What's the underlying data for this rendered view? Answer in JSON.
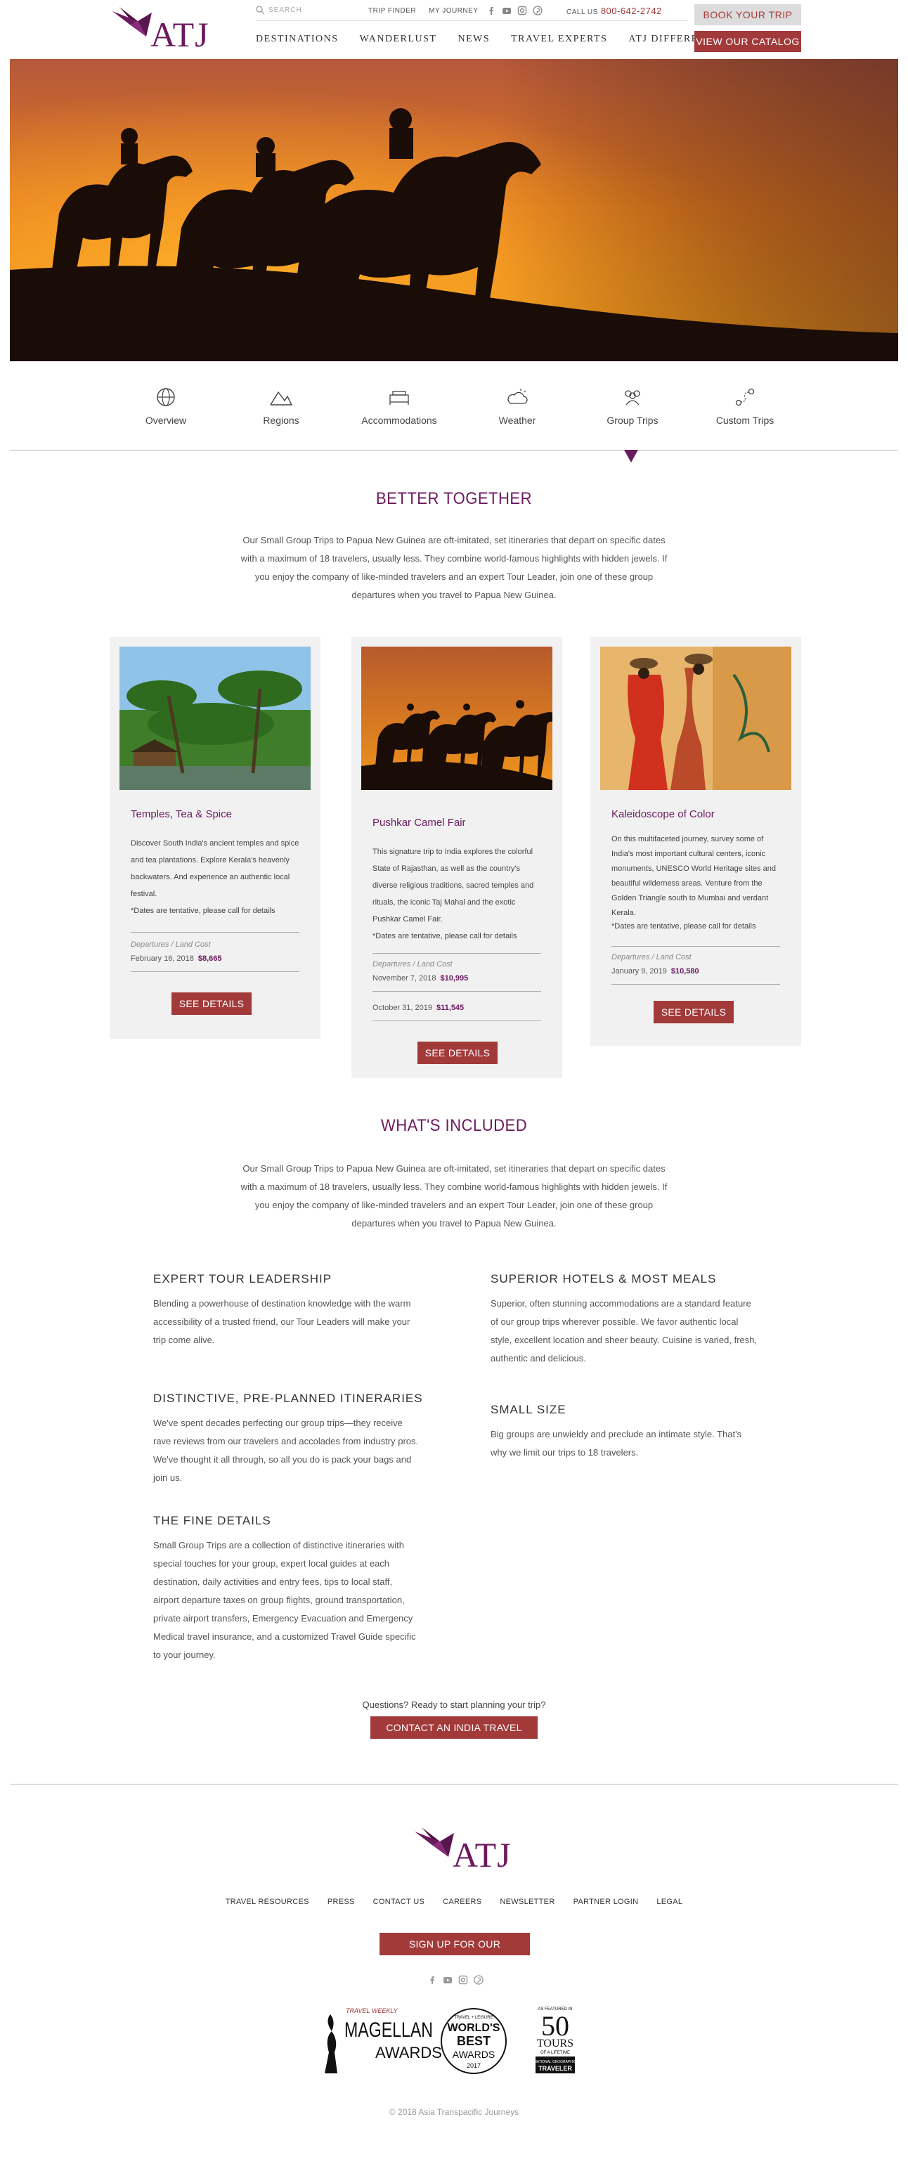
{
  "brand": {
    "logo_text": "ATJ",
    "plum": "#6b1a5e",
    "red": "#a33a3a"
  },
  "header": {
    "search_placeholder": "SEARCH",
    "top_links": [
      "TRIP FINDER",
      "MY JOURNEY"
    ],
    "social_icons": [
      "facebook-icon",
      "youtube-icon",
      "instagram-icon",
      "pinterest-icon"
    ],
    "call_label": "CALL US",
    "phone": "800-642-2742",
    "nav": [
      "DESTINATIONS",
      "WANDERLUST",
      "NEWS",
      "TRAVEL EXPERTS",
      "ATJ DIFFERENCE"
    ],
    "book_button": "BOOK YOUR TRIP",
    "catalog_button": "VIEW OUR CATALOG"
  },
  "tabs": [
    {
      "label": "Overview",
      "icon": "globe-icon"
    },
    {
      "label": "Regions",
      "icon": "mountains-icon"
    },
    {
      "label": "Accommodations",
      "icon": "hotel-icon"
    },
    {
      "label": "Weather",
      "icon": "cloud-sun-icon"
    },
    {
      "label": "Group Trips",
      "icon": "group-icon",
      "active": true
    },
    {
      "label": "Custom Trips",
      "icon": "route-icon"
    }
  ],
  "better_together": {
    "title": "BETTER TOGETHER",
    "intro": "Our Small Group Trips to Papua New Guinea are oft-imitated, set itineraries that depart on specific dates with a maximum of 18 travelers, usually less. They combine world-famous highlights with hidden jewels. If you enjoy the company of like-minded travelers and an expert Tour Leader, join one of these group departures when you travel to Papua New Guinea."
  },
  "cards": [
    {
      "title": "Temples, Tea & Spice",
      "description": "Discover South India's ancient temples and spice and tea plantations. Explore Kerala's heavenly backwaters. And experience an authentic local festival.",
      "note": "*Dates are tentative, please call for details",
      "dates_label": "Departures / Land Cost",
      "departures": [
        {
          "date": "February 16, 2018",
          "price": "$8,665"
        }
      ],
      "button": "SEE DETAILS"
    },
    {
      "title": "Pushkar Camel Fair",
      "description": "This signature trip to India explores the colorful State of Rajasthan, as well as the country's diverse religious traditions, sacred temples and rituals, the iconic Taj Mahal and the exotic Pushkar Camel Fair.",
      "note": "*Dates are tentative, please call for details",
      "dates_label": "Departures / Land Cost",
      "departures": [
        {
          "date": "November 7, 2018",
          "price": "$10,995"
        },
        {
          "date": "October 31, 2019",
          "price": "$11,545"
        }
      ],
      "button": "SEE DETAILS"
    },
    {
      "title": "Kaleidoscope of Color",
      "description": "On this multifaceted journey, survey some of India's most important cultural centers, iconic monuments, UNESCO World Heritage sites and beautiful wilderness areas. Venture from the Golden Triangle south to Mumbai and verdant Kerala.",
      "note": "*Dates are tentative, please call for details",
      "dates_label": "Departures / Land Cost",
      "departures": [
        {
          "date": "January 9, 2019",
          "price": "$10,580"
        }
      ],
      "button": "SEE DETAILS"
    }
  ],
  "included": {
    "title": "WHAT'S INCLUDED",
    "intro": "Our Small Group Trips to Papua New Guinea are oft-imitated, set itineraries that depart on specific dates with a maximum of 18 travelers, usually less. They combine world-famous highlights with hidden jewels. If you enjoy the company of like-minded travelers and an expert Tour Leader, join one of these group departures when you travel to Papua New Guinea.",
    "items": [
      {
        "heading": "EXPERT TOUR LEADERSHIP",
        "text": "Blending a powerhouse of destination knowledge with the warm accessibility of a trusted friend, our Tour Leaders will make your trip come alive."
      },
      {
        "heading": "SUPERIOR HOTELS & MOST MEALS",
        "text": "Superior, often stunning accommodations are a standard feature of our group trips wherever possible. We favor authentic local style, excellent location and sheer beauty. Cuisine is varied, fresh, authentic and delicious."
      },
      {
        "heading": "DISTINCTIVE, PRE-PLANNED ITINERARIES",
        "text": "We've spent decades perfecting our group trips—they receive rave reviews from our travelers and accolades from industry pros. We've thought it all through, so all you do is pack your bags and join us."
      },
      {
        "heading": "SMALL SIZE",
        "text": "Big groups are unwieldy and preclude an intimate style. That's why we limit our trips to 18 travelers."
      },
      {
        "heading": "THE FINE DETAILS",
        "text": "Small Group Trips are a collection of distinctive itineraries with special touches for your group, expert local guides at each destination, daily activities and entry fees, tips to local staff, airport departure taxes on group flights, ground transportation, private airport transfers, Emergency Evacuation and Emergency Medical travel insurance, and a customized Travel Guide specific to your journey."
      }
    ]
  },
  "cta": {
    "question": "Questions? Ready to start planning your trip?",
    "button": "CONTACT AN INDIA TRAVEL EXPERT"
  },
  "footer": {
    "links": [
      "TRAVEL RESOURCES",
      "PRESS",
      "CONTACT US",
      "CAREERS",
      "NEWSLETTER",
      "PARTNER LOGIN",
      "LEGAL"
    ],
    "newsletter_button": "SIGN UP FOR OUR NEWSLETTER",
    "social_icons": [
      "facebook-icon",
      "youtube-icon",
      "instagram-icon",
      "pinterest-icon"
    ],
    "awards": {
      "magellan_top": "TRAVEL WEEKLY",
      "magellan_main": "MAGELLAN",
      "magellan_sub": "AWARDS",
      "wb_top": "TRAVEL + LEISURE",
      "wb_main1": "WORLD'S",
      "wb_main2": "BEST",
      "wb_main3": "AWARDS",
      "wb_year": "2017",
      "tours_top": "AS FEATURED IN",
      "tours_num": "50",
      "tours_word": "TOURS",
      "tours_sub": "OF A LIFETIME",
      "tours_brand1": "NATIONAL GEOGRAPHIC",
      "tours_brand2": "TRAVELER"
    },
    "copyright": "© 2018 Asia Transpacific Journeys"
  }
}
